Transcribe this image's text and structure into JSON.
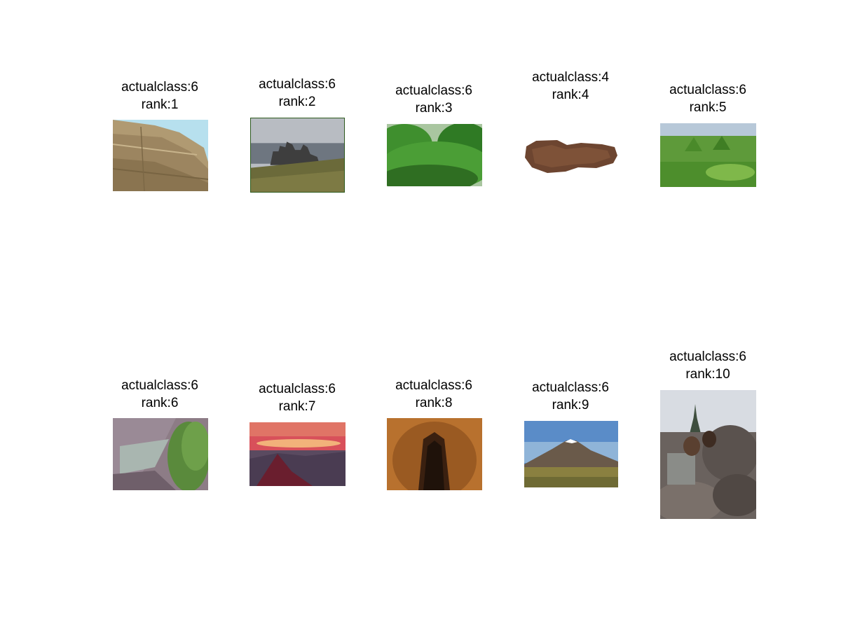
{
  "results": [
    {
      "actual_class": "actualclass:6",
      "rank": "rank:1",
      "scene": "sandstone-cliff"
    },
    {
      "actual_class": "actualclass:6",
      "rank": "rank:2",
      "scene": "castle-ruin-coast"
    },
    {
      "actual_class": "actualclass:6",
      "rank": "rank:3",
      "scene": "green-hills-valley"
    },
    {
      "actual_class": "actualclass:4",
      "rank": "rank:4",
      "scene": "rock-fragment"
    },
    {
      "actual_class": "actualclass:6",
      "rank": "rank:5",
      "scene": "green-hills-plain"
    },
    {
      "actual_class": "actualclass:6",
      "rank": "rank:6",
      "scene": "rock-face-pine"
    },
    {
      "actual_class": "actualclass:6",
      "rank": "rank:7",
      "scene": "sunset-mountains"
    },
    {
      "actual_class": "actualclass:6",
      "rank": "rank:8",
      "scene": "cave-tunnel"
    },
    {
      "actual_class": "actualclass:6",
      "rank": "rank:9",
      "scene": "volcano-landscape"
    },
    {
      "actual_class": "actualclass:6",
      "rank": "rank:10",
      "scene": "person-on-rocks"
    }
  ]
}
